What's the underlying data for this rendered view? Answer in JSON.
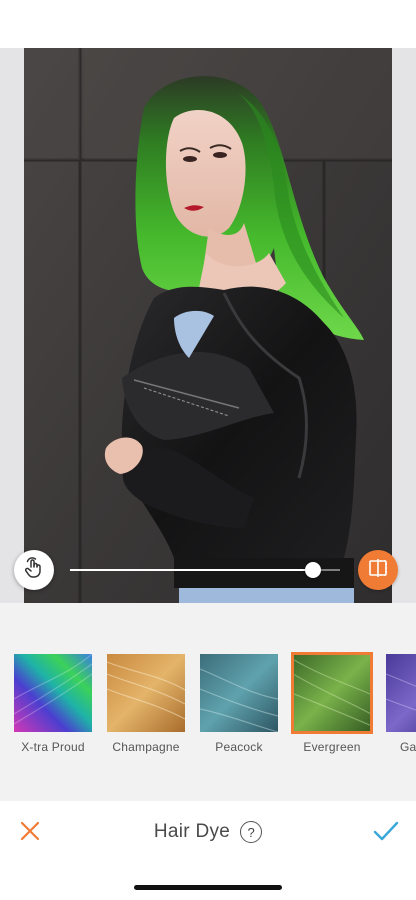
{
  "editor": {
    "intensity": 0.9,
    "icons": {
      "touch": "hand-touch-icon",
      "compare": "compare-split-icon"
    }
  },
  "palette": {
    "accent": "#f07b35",
    "check": "#3aa7d9",
    "hair_tint": "#3fb82b"
  },
  "swatches": [
    {
      "label": "X-tra Proud",
      "selected": false
    },
    {
      "label": "Champagne",
      "selected": false
    },
    {
      "label": "Peacock",
      "selected": false
    },
    {
      "label": "Evergreen",
      "selected": true
    },
    {
      "label": "Ga",
      "selected": false
    }
  ],
  "toolbar": {
    "title": "Hair Dye",
    "help_label": "?",
    "icons": {
      "cancel": "close-icon",
      "confirm": "checkmark-icon"
    }
  }
}
